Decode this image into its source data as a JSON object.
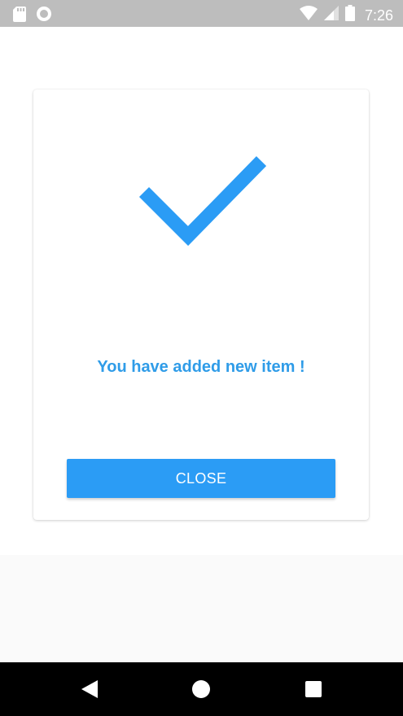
{
  "status_bar": {
    "time": "7:26",
    "icons": [
      "sd-card-icon",
      "circle-notification-icon",
      "wifi-icon",
      "cell-signal-icon",
      "battery-icon"
    ]
  },
  "dialog": {
    "icon": "checkmark-icon",
    "message": "You have added new item !",
    "close_label": "CLOSE"
  },
  "nav_bar": {
    "icons": [
      "back-icon",
      "home-icon",
      "recents-icon"
    ]
  },
  "colors": {
    "accent": "#2b9cf5",
    "message_text": "#2f9ce8",
    "status_bar": "#bdbdbd",
    "nav_bar": "#000000"
  }
}
